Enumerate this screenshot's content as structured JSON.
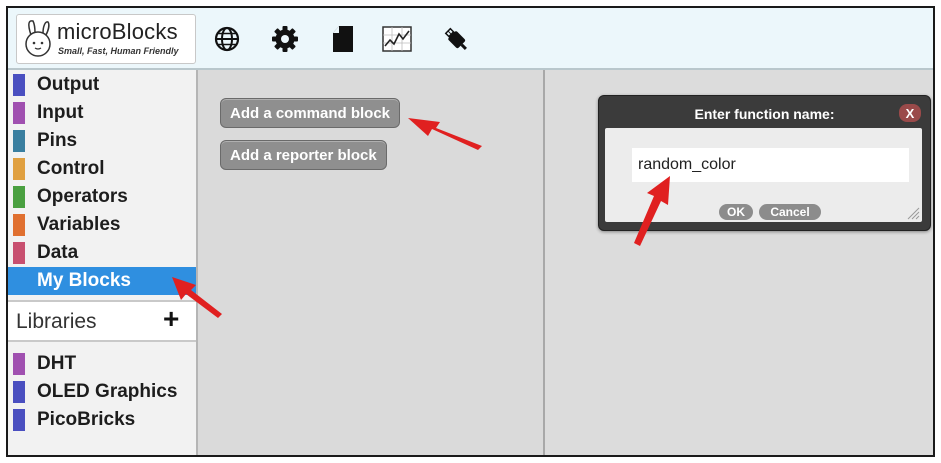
{
  "app": {
    "name": "microBlocks",
    "tagline": "Small, Fast, Human Friendly"
  },
  "toolbar": {
    "icons": [
      "globe-icon",
      "gear-icon",
      "file-icon",
      "graph-icon",
      "usb-plug-icon"
    ]
  },
  "categories": [
    {
      "label": "Output",
      "color": "#4a4fc0"
    },
    {
      "label": "Input",
      "color": "#a050b0"
    },
    {
      "label": "Pins",
      "color": "#3a7fa0"
    },
    {
      "label": "Control",
      "color": "#e0a040"
    },
    {
      "label": "Operators",
      "color": "#4aa040"
    },
    {
      "label": "Variables",
      "color": "#e07030"
    },
    {
      "label": "Data",
      "color": "#c85070"
    },
    {
      "label": "My Blocks",
      "color": "#2f8fe0",
      "selected": true
    }
  ],
  "libraries": {
    "label": "Libraries",
    "add_symbol": "+",
    "items": [
      {
        "label": "DHT",
        "color": "#a050b0"
      },
      {
        "label": "OLED Graphics",
        "color": "#4a4fc0"
      },
      {
        "label": "PicoBricks",
        "color": "#4a4fc0"
      }
    ]
  },
  "palette": {
    "add_command": "Add a command block",
    "add_reporter": "Add a reporter block"
  },
  "dialog": {
    "title": "Enter function name:",
    "close": "X",
    "input_value": "random_color",
    "ok": "OK",
    "cancel": "Cancel"
  },
  "colors": {
    "annotation_arrow": "#e02020",
    "selected_category": "#2f8fe0"
  }
}
